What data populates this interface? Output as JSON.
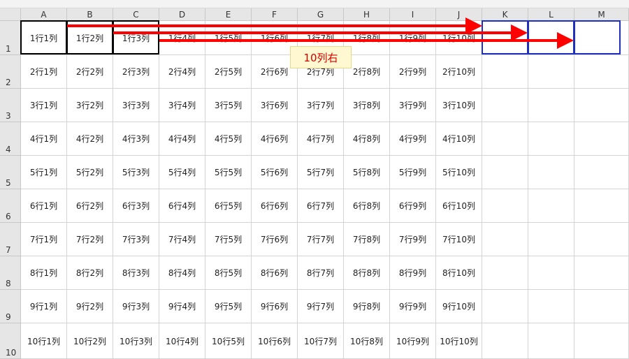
{
  "columns": [
    "A",
    "B",
    "C",
    "D",
    "E",
    "F",
    "G",
    "H",
    "I",
    "J",
    "K",
    "L",
    "M"
  ],
  "rows": [
    "1",
    "2",
    "3",
    "4",
    "5",
    "6",
    "7",
    "8",
    "9",
    "10"
  ],
  "cells": [
    [
      "1行1列",
      "1行2列",
      "1行3列",
      "1行4列",
      "1行5列",
      "1行6列",
      "1行7列",
      "1行8列",
      "1行9列",
      "1行10列",
      "",
      "",
      ""
    ],
    [
      "2行1列",
      "2行2列",
      "2行3列",
      "2行4列",
      "2行5列",
      "2行6列",
      "2行7列",
      "2行8列",
      "2行9列",
      "2行10列",
      "",
      "",
      ""
    ],
    [
      "3行1列",
      "3行2列",
      "3行3列",
      "3行4列",
      "3行5列",
      "3行6列",
      "3行7列",
      "3行8列",
      "3行9列",
      "3行10列",
      "",
      "",
      ""
    ],
    [
      "4行1列",
      "4行2列",
      "4行3列",
      "4行4列",
      "4行5列",
      "4行6列",
      "4行7列",
      "4行8列",
      "4行9列",
      "4行10列",
      "",
      "",
      ""
    ],
    [
      "5行1列",
      "5行2列",
      "5行3列",
      "5行4列",
      "5行5列",
      "5行6列",
      "5行7列",
      "5行8列",
      "5行9列",
      "5行10列",
      "",
      "",
      ""
    ],
    [
      "6行1列",
      "6行2列",
      "6行3列",
      "6行4列",
      "6行5列",
      "6行6列",
      "6行7列",
      "6行8列",
      "6行9列",
      "6行10列",
      "",
      "",
      ""
    ],
    [
      "7行1列",
      "7行2列",
      "7行3列",
      "7行4列",
      "7行5列",
      "7行6列",
      "7行7列",
      "7行8列",
      "7行9列",
      "7行10列",
      "",
      "",
      ""
    ],
    [
      "8行1列",
      "8行2列",
      "8行3列",
      "8行4列",
      "8行5列",
      "8行6列",
      "8行7列",
      "8行8列",
      "8行9列",
      "8行10列",
      "",
      "",
      ""
    ],
    [
      "9行1列",
      "9行2列",
      "9行3列",
      "9行4列",
      "9行5列",
      "9行6列",
      "9行7列",
      "9行8列",
      "9行9列",
      "9行10列",
      "",
      "",
      ""
    ],
    [
      "10行1列",
      "10行2列",
      "10行3列",
      "10行4列",
      "10行5列",
      "10行6列",
      "10行7列",
      "10行8列",
      "10行9列",
      "10行10列",
      "",
      "",
      ""
    ]
  ],
  "callout": {
    "text": "10列右"
  },
  "colors": {
    "arrow": "#ff0000",
    "callout_text": "#d40000",
    "source_border": "#000000",
    "target_border": "#1f2fbf"
  }
}
